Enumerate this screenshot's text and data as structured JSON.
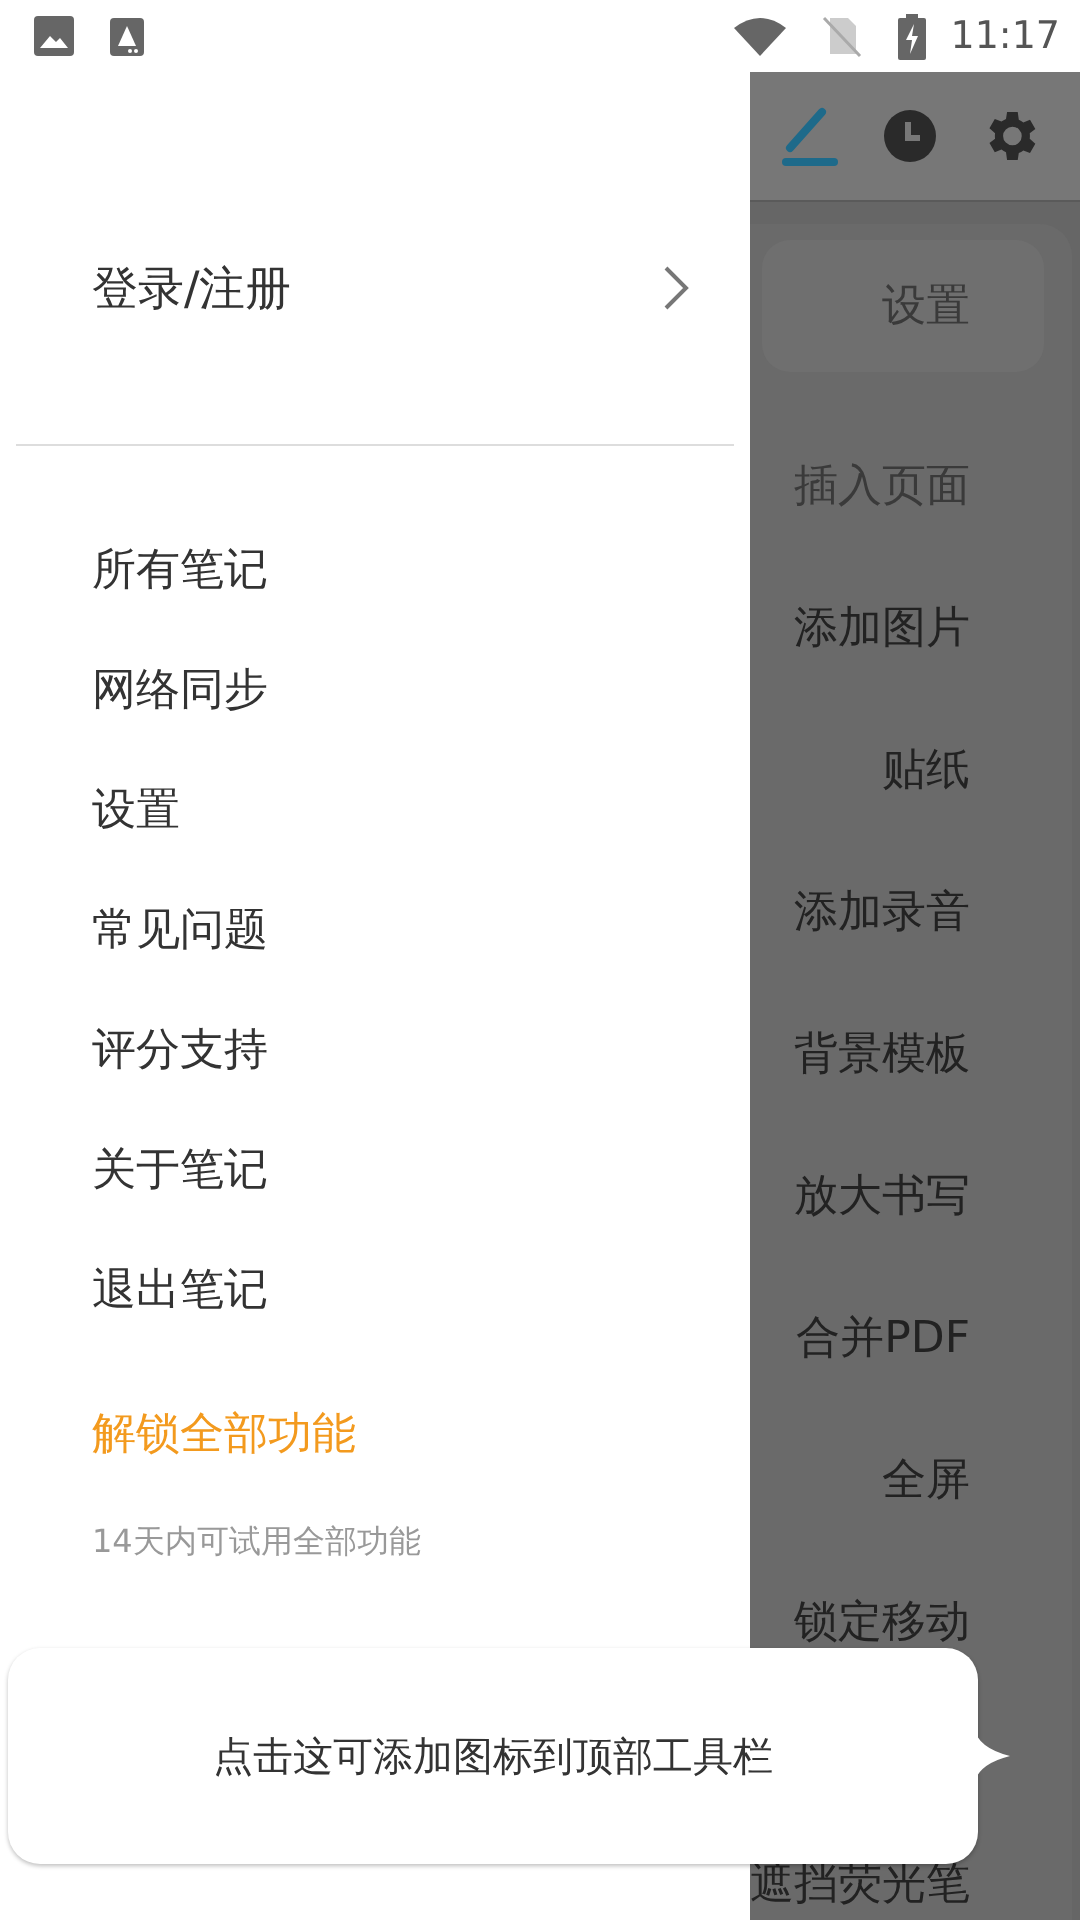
{
  "status_bar": {
    "time": "11:17"
  },
  "toolbar": {
    "tools": [
      {
        "kind": "pen",
        "selected": true
      },
      {
        "kind": "history",
        "selected": false
      },
      {
        "kind": "settings",
        "selected": false
      }
    ]
  },
  "menu": {
    "items": [
      {
        "label": "设置",
        "selected": true,
        "disabled": false
      },
      {
        "label": "插入页面",
        "selected": false,
        "disabled": true
      },
      {
        "label": "添加图片",
        "selected": false,
        "disabled": false
      },
      {
        "label": "贴纸",
        "selected": false,
        "disabled": false
      },
      {
        "label": "添加录音",
        "selected": false,
        "disabled": false
      },
      {
        "label": "背景模板",
        "selected": false,
        "disabled": false
      },
      {
        "label": "放大书写",
        "selected": false,
        "disabled": false
      },
      {
        "label": "合并PDF",
        "selected": false,
        "disabled": false
      },
      {
        "label": "全屏",
        "selected": false,
        "disabled": false
      },
      {
        "label": "锁定移动",
        "selected": false,
        "disabled": false
      },
      {
        "label": "遮挡荧光笔",
        "selected": false,
        "disabled": false
      }
    ]
  },
  "drawer": {
    "account": "登录/注册",
    "items": [
      {
        "label": "所有笔记"
      },
      {
        "label": "网络同步"
      },
      {
        "label": "设置"
      },
      {
        "label": "常见问题"
      },
      {
        "label": "评分支持"
      },
      {
        "label": "关于笔记"
      },
      {
        "label": "退出笔记"
      }
    ],
    "unlock": {
      "title": "解锁全部功能",
      "subtitle": "14天内可试用全部功能"
    }
  },
  "tooltip": {
    "text": "点击这可添加图标到顶部工具栏"
  }
}
